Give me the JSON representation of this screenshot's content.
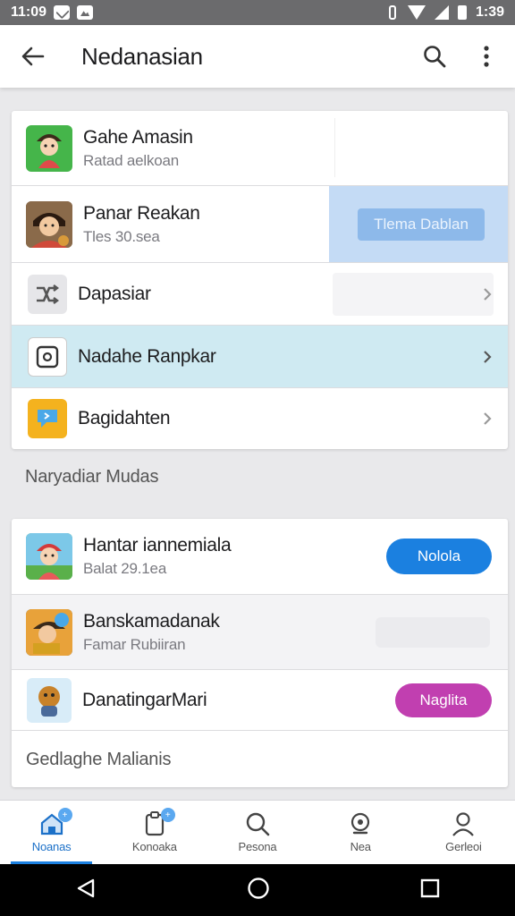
{
  "status_bar": {
    "time_left": "11:09",
    "time_right": "1:39"
  },
  "app_bar": {
    "title": "Nedanasian"
  },
  "card1": {
    "rows": [
      {
        "title": "Gahe Amasin",
        "subtitle": "Ratad aelkoan"
      },
      {
        "title": "Panar Reakan",
        "subtitle": "Tles 30.sea",
        "button": "Tlema Dablan"
      },
      {
        "title": "Dapasiar"
      },
      {
        "title": "Nadahe Ranpkar"
      },
      {
        "title": "Bagidahten"
      }
    ]
  },
  "section_label": "Naryadiar Mudas",
  "card2": {
    "rows": [
      {
        "title": "Hantar iannemiala",
        "subtitle": "Balat 29.1ea",
        "button": "Nolola"
      },
      {
        "title": "Banskamadanak",
        "subtitle": "Famar Rubiiran"
      },
      {
        "title": "DanatingarMari",
        "button": "Naglita"
      }
    ],
    "footer": "Gedlaghe Malianis"
  },
  "bottom_nav": {
    "items": [
      {
        "label": "Noanas",
        "icon": "home-icon",
        "active": true
      },
      {
        "label": "Konoaka",
        "icon": "clipboard-icon"
      },
      {
        "label": "Pesona",
        "icon": "search-icon"
      },
      {
        "label": "Nea",
        "icon": "notification-icon"
      },
      {
        "label": "Gerleoi",
        "icon": "profile-icon"
      }
    ]
  },
  "colors": {
    "accent": "#1b80e0",
    "magenta": "#c13fb0",
    "highlight_cyan": "#cfeaf2",
    "highlight_blue": "#c4dbf5"
  }
}
